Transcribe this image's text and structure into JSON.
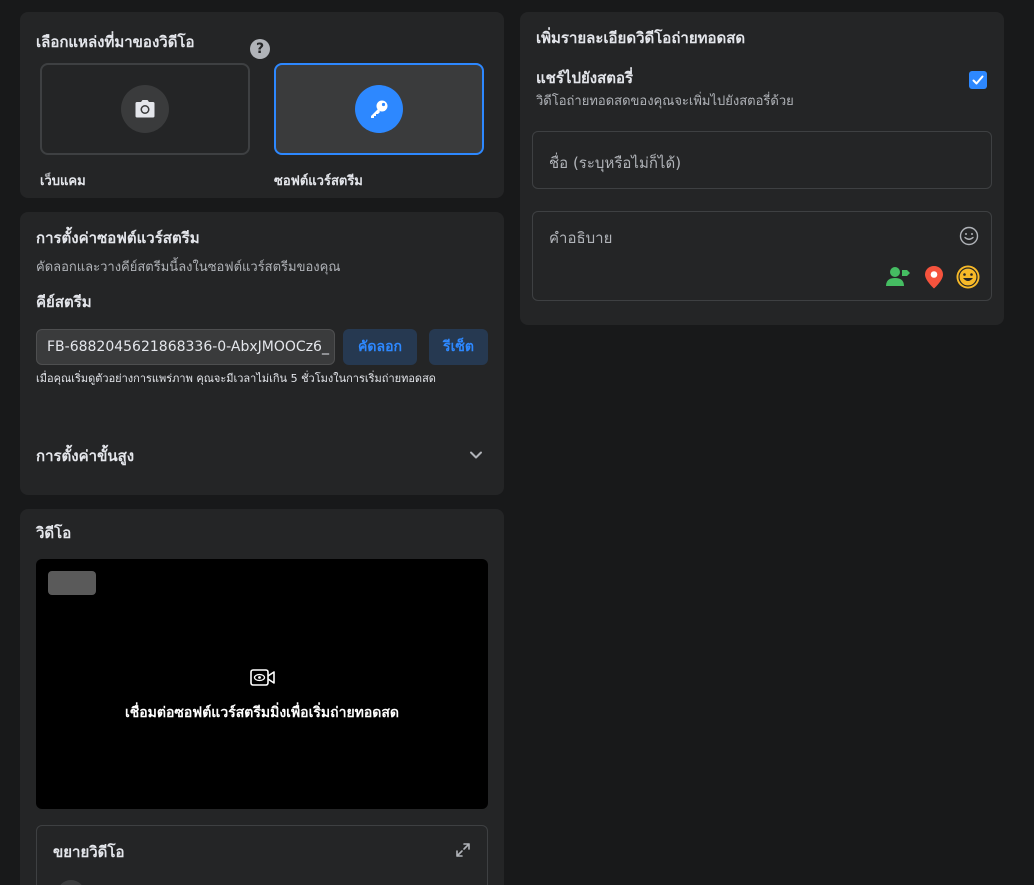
{
  "source": {
    "title": "เลือกแหล่งที่มาของวิดีโอ",
    "help": "?",
    "options": [
      {
        "label": "เว็บแคม",
        "icon": "camera-icon",
        "selected": false
      },
      {
        "label": "ซอฟต์แวร์สตรีม",
        "icon": "key-icon",
        "selected": true
      }
    ]
  },
  "setup": {
    "title": "การตั้งค่าซอฟต์แวร์สตรีม",
    "description": "คัดลอกและวางคีย์สตรีมนี้ลงในซอฟต์แวร์สตรีมของคุณ",
    "stream_key_label": "คีย์สตรีม",
    "stream_key_value": "FB-6882045621868336-0-AbxJMOOCz6_",
    "copy_label": "คัดลอก",
    "reset_label": "รีเซ็ต",
    "hint": "เมื่อคุณเริ่มดูตัวอย่างการแพร่ภาพ คุณจะมีเวลาไม่เกิน 5 ชั่วโมงในการเริ่มถ่ายทอดสด",
    "advanced_label": "การตั้งค่าขั้นสูง"
  },
  "video": {
    "title": "วิดีโอ",
    "connect_message": "เชื่อมต่อซอฟต์แวร์สตรีมมิ่งเพื่อเริ่มถ่ายทอดสด",
    "expand_title": "ขยายวิดีโอ"
  },
  "details": {
    "title": "เพิ่มรายละเอียดวิดีโอถ่ายทอดสด",
    "share_story_title": "แชร์ไปยังสตอรี่",
    "share_story_desc": "วิดีโอถ่ายทอดสดของคุณจะเพิ่มไปยังสตอรี่ด้วย",
    "share_story_checked": true,
    "name_placeholder": "ชื่อ (ระบุหรือไม่ก็ได้)",
    "description_placeholder": "คำอธิบาย"
  },
  "colors": {
    "accent": "#2d88ff",
    "tag_green": "#45bd62",
    "location_red": "#f5533d",
    "emoji_yellow": "#f7b928"
  }
}
